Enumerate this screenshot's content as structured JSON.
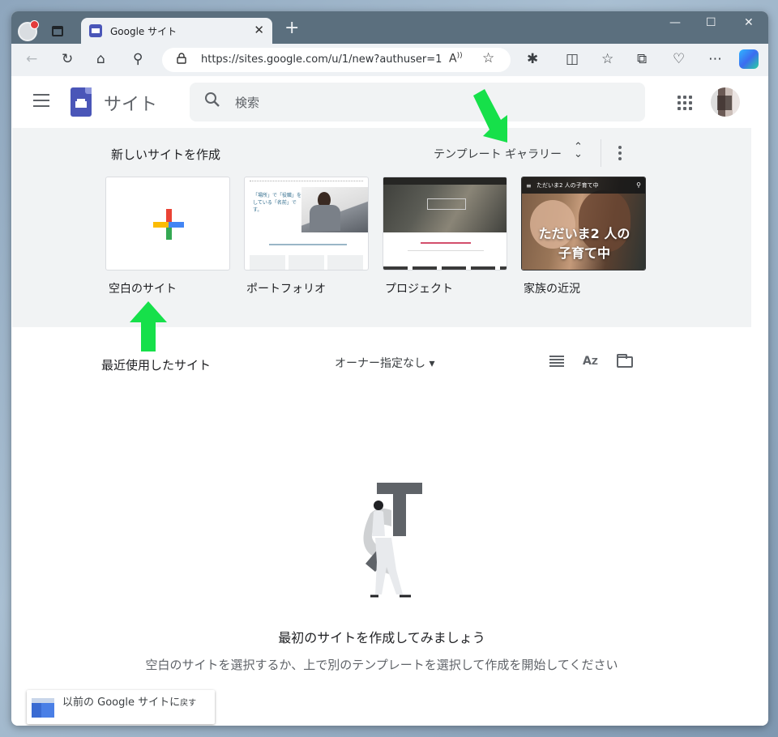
{
  "browser": {
    "tab_title": "Google サイト",
    "tab_close": "✕",
    "new_tab": "+",
    "window_controls": {
      "minimize": "—",
      "maximize": "☐",
      "close": "✕"
    },
    "toolbar": {
      "back": "←",
      "reload": "↻",
      "home": "⌂",
      "search": "⚲",
      "url": "https://sites.google.com/u/1/new?authuser=1",
      "lock": "🔒",
      "read_aloud": "A̩",
      "favorite": "☆",
      "extensions": "✱",
      "split": "◫",
      "favorites": "☆",
      "collections": "⧉",
      "performance": "♡",
      "more": "⋯"
    }
  },
  "app": {
    "name": "サイト",
    "search_placeholder": "検索",
    "search_icon": "⚲"
  },
  "templates": {
    "heading": "新しいサイトを作成",
    "gallery_label": "テンプレート ギャラリー",
    "gallery_toggle": "⌃⌄",
    "cards": [
      {
        "label": "空白のサイト"
      },
      {
        "label": "ポートフォリオ",
        "thumb_text": "「場所」で「役職」をしている「名前」です。"
      },
      {
        "label": "プロジェクト"
      },
      {
        "label": "家族の近況",
        "thumb_bar": "ただいま2 人の子育て中",
        "thumb_title": "ただいま2 人の\n子育て中",
        "menu": "≡",
        "search": "⚲"
      }
    ],
    "plus_colors": {
      "red": "#ea4335",
      "blue": "#4285f4",
      "green": "#34a853",
      "yellow": "#fbbc04"
    }
  },
  "recent": {
    "heading": "最近使用したサイト",
    "owner_filter": "オーナー指定なし ▾",
    "sort_icon": "A͢Z"
  },
  "empty_state": {
    "title": "最初のサイトを作成してみましょう",
    "subtitle": "空白のサイトを選択するか、上で別のテンプレートを選択して作成を開始してください"
  },
  "classic": {
    "label_main": "以前の Google サイトに",
    "label_small": "戻す"
  },
  "colors": {
    "tabstrip": "#5b6f7e",
    "toolbar": "#eef1f4",
    "templates_bg": "#f1f3f4",
    "brand": "#4a56b8",
    "annotation_arrow": "#16e04a"
  }
}
